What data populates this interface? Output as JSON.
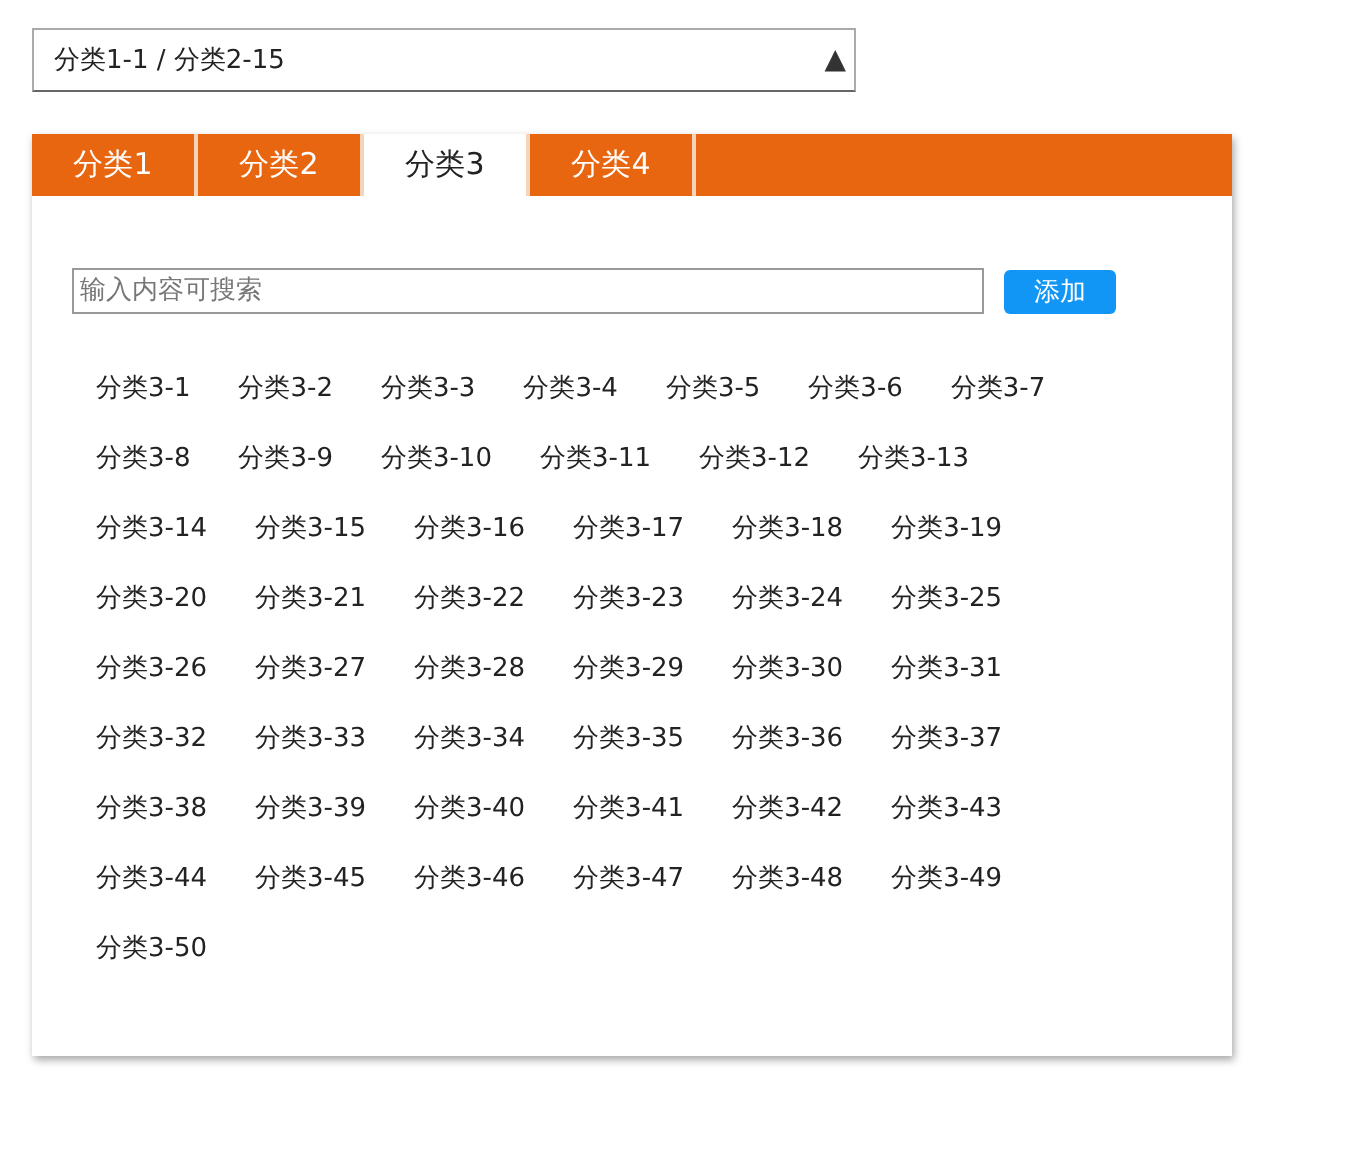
{
  "dropdown": {
    "value": "分类1-1 / 分类2-15",
    "arrow": "▲",
    "expanded": true
  },
  "tabs": [
    {
      "label": "分类1",
      "selected": false
    },
    {
      "label": "分类2",
      "selected": false
    },
    {
      "label": "分类3",
      "selected": true
    },
    {
      "label": "分类4",
      "selected": false
    }
  ],
  "search": {
    "placeholder": "输入内容可搜索"
  },
  "add_button": "添加",
  "items": [
    "分类3-1",
    "分类3-2",
    "分类3-3",
    "分类3-4",
    "分类3-5",
    "分类3-6",
    "分类3-7",
    "分类3-8",
    "分类3-9",
    "分类3-10",
    "分类3-11",
    "分类3-12",
    "分类3-13",
    "分类3-14",
    "分类3-15",
    "分类3-16",
    "分类3-17",
    "分类3-18",
    "分类3-19",
    "分类3-20",
    "分类3-21",
    "分类3-22",
    "分类3-23",
    "分类3-24",
    "分类3-25",
    "分类3-26",
    "分类3-27",
    "分类3-28",
    "分类3-29",
    "分类3-30",
    "分类3-31",
    "分类3-32",
    "分类3-33",
    "分类3-34",
    "分类3-35",
    "分类3-36",
    "分类3-37",
    "分类3-38",
    "分类3-39",
    "分类3-40",
    "分类3-41",
    "分类3-42",
    "分类3-43",
    "分类3-44",
    "分类3-45",
    "分类3-46",
    "分类3-47",
    "分类3-48",
    "分类3-49",
    "分类3-50"
  ]
}
